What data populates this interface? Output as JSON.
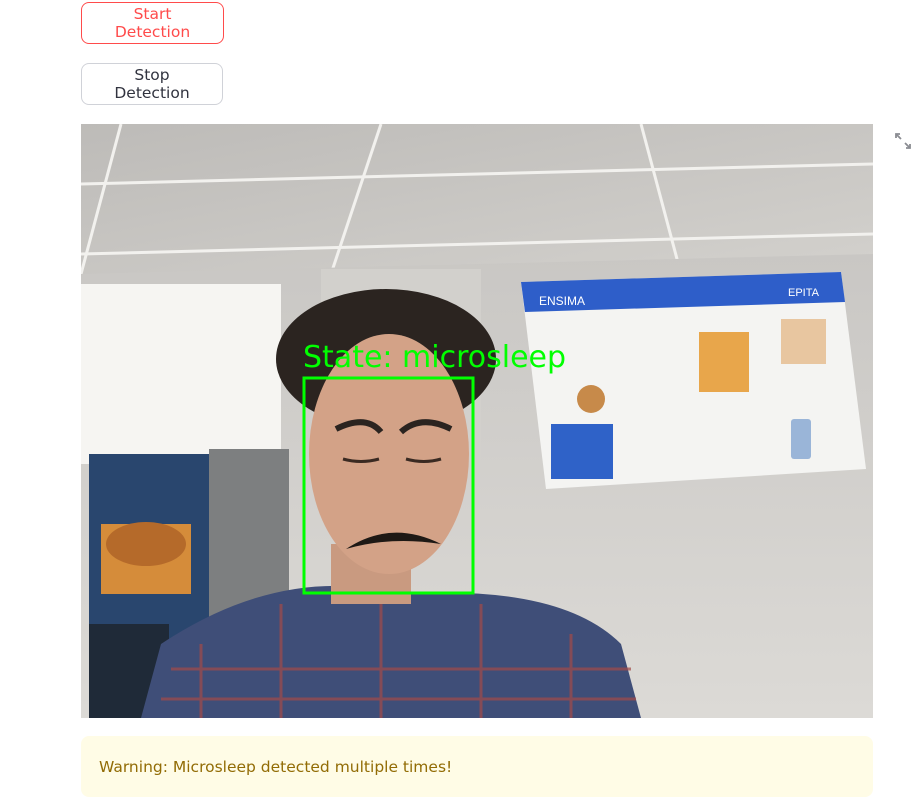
{
  "controls": {
    "start_label": "Start Detection",
    "stop_label": "Stop Detection"
  },
  "video": {
    "overlay_state_text": "State: microsleep",
    "overlay_color": "#00ff00",
    "poster_brand_left": "ENSIMA",
    "poster_brand_right": "EPITA",
    "expand_icon": "fullscreen-expand-icon"
  },
  "alert": {
    "message": "Warning: Microsleep detected multiple times!",
    "background": "#fffce6",
    "text_color": "#926c05"
  },
  "colors": {
    "primary": "#ff4b4b",
    "border": "#d0d2d8",
    "text": "#31333f"
  }
}
